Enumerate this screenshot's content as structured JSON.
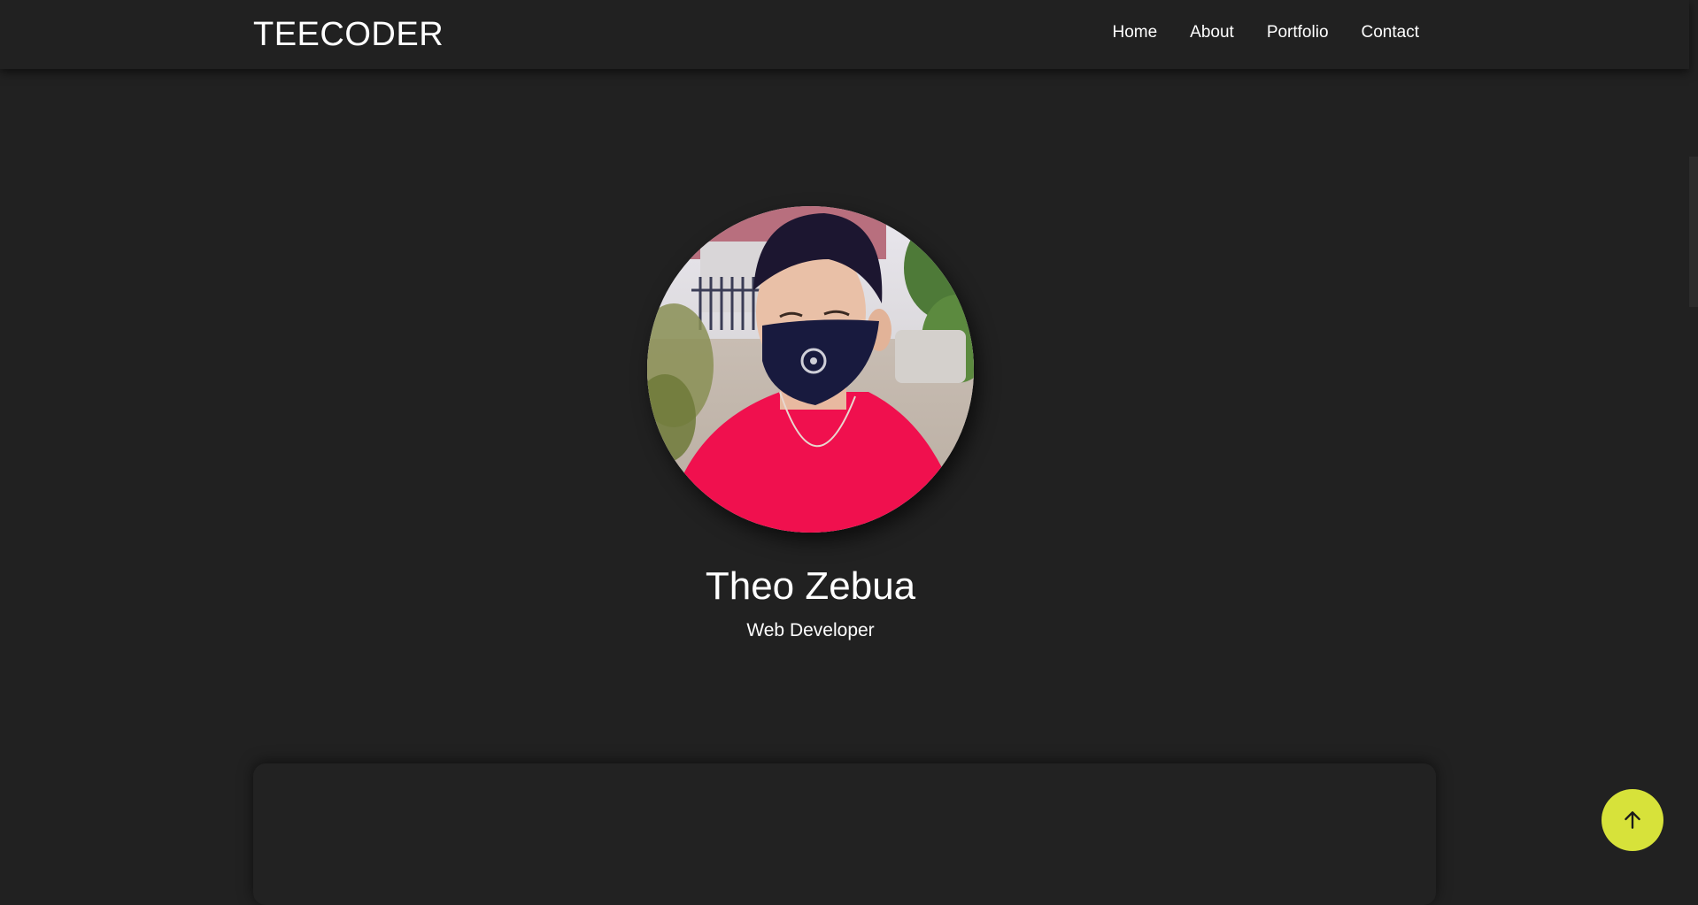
{
  "navbar": {
    "brand": "TEECODER",
    "links": [
      {
        "label": "Home"
      },
      {
        "label": "About"
      },
      {
        "label": "Portfolio"
      },
      {
        "label": "Contact"
      }
    ]
  },
  "hero": {
    "name": "Theo Zebua",
    "role": "Web Developer",
    "avatar_icon": "profile-photo"
  },
  "back_to_top": {
    "icon": "arrow-up-icon"
  },
  "colors": {
    "background": "#212121",
    "text": "#ffffff",
    "accent": "#d7e23a"
  }
}
